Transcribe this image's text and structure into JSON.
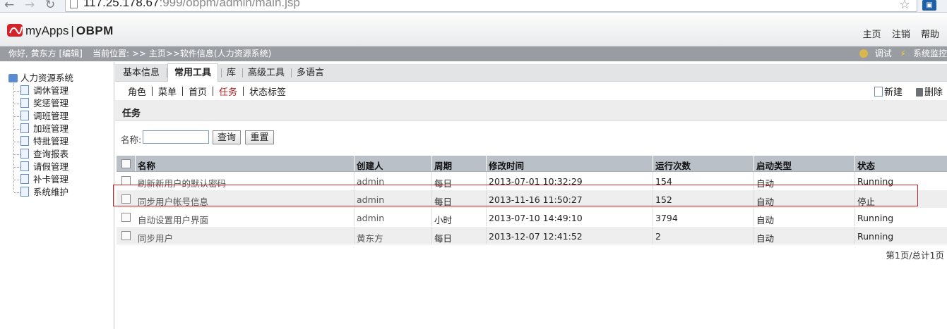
{
  "browser": {
    "url_host": "117.25.178.67",
    "url_rest": ":999/obpm/admin/main.jsp"
  },
  "header": {
    "logo_name": "myApps",
    "logo_product": "OBPM",
    "links": [
      "主页",
      "注销",
      "帮助"
    ]
  },
  "status": {
    "greeting": "你好, 黄东方 [编辑]",
    "location": "当前位置: >> 主页>>软件信息(人力资源系统)",
    "debug_label": "调试",
    "monitor_label": "系统监控"
  },
  "sidebar": {
    "root": "人力资源系统",
    "items": [
      "调休管理",
      "奖惩管理",
      "调班管理",
      "加班管理",
      "特批管理",
      "查询报表",
      "请假管理",
      "补卡管理",
      "系统维护"
    ]
  },
  "tabs": [
    "基本信息",
    "常用工具",
    "库",
    "高级工具",
    "多语言"
  ],
  "active_tab": "常用工具",
  "subtabs": [
    "角色",
    "菜单",
    "首页",
    "任务",
    "状态标签"
  ],
  "active_subtab": "任务",
  "toolbar": {
    "new_label": "新建",
    "delete_label": "删除"
  },
  "section_title": "任务",
  "search": {
    "label": "名称:",
    "value": "",
    "query_label": "查询",
    "reset_label": "重置"
  },
  "table": {
    "columns": [
      "名称",
      "创建人",
      "周期",
      "修改时间",
      "运行次数",
      "启动类型",
      "状态"
    ],
    "rows": [
      [
        "刷新新用户的默认密码",
        "admin",
        "每日",
        "2013-07-01 10:32:29",
        "154",
        "自动",
        "Running"
      ],
      [
        "同步用户帐号信息",
        "admin",
        "每日",
        "2013-11-16 11:50:27",
        "152",
        "自动",
        "停止"
      ],
      [
        "自动设置用户界面",
        "admin",
        "小时",
        "2013-07-10 14:49:10",
        "3794",
        "自动",
        "Running"
      ],
      [
        "同步用户",
        "黄东方",
        "每日",
        "2013-12-07 12:41:52",
        "2",
        "自动",
        "Running"
      ]
    ]
  },
  "pager": "第1页/总计1页",
  "colors": {
    "highlight": "#c8262a",
    "active_subtab": "#b22222",
    "statusbar": "#999da1"
  }
}
